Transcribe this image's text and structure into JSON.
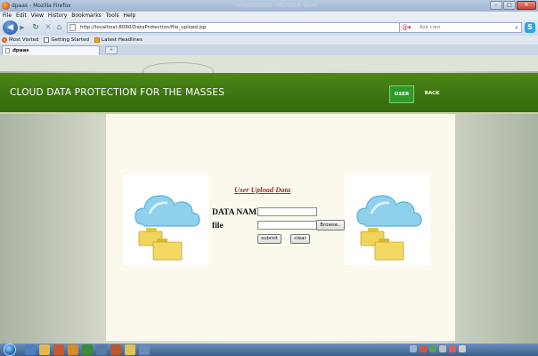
{
  "window": {
    "title": "dpaas - Mozilla Firefox",
    "ghost_title": "ondpaadasds - Microsoft Word",
    "buttons": {
      "minimize": "–",
      "maximize": "□",
      "close": "✕"
    }
  },
  "menu": [
    "File",
    "Edit",
    "View",
    "History",
    "Bookmarks",
    "Tools",
    "Help"
  ],
  "toolbar": {
    "url": "http://localhost:8080/DataProtection/file_upload.jsp",
    "search_placeholder": "Ask.com",
    "icons": [
      "back-icon",
      "forward-icon",
      "reload-icon",
      "stop-icon",
      "home-icon",
      "star-icon",
      "search-icon",
      "skype-icon"
    ]
  },
  "bookmarks": [
    "Most Visited",
    "Getting Started",
    "Latest Headlines"
  ],
  "tab": {
    "label": "dpaas"
  },
  "site": {
    "title": "CLOUD DATA PROTECTION FOR THE MASSES",
    "nav": {
      "user": "USER",
      "back": "BACK"
    }
  },
  "form": {
    "heading": "User Upload Data",
    "data_name_label": "DATA NAME",
    "file_label": "file",
    "browse_label": "Browse..",
    "submit_label": "submit",
    "clear_label": "clear"
  },
  "colors": {
    "header_green": "#3c7410",
    "active_nav": "#2e9a2a",
    "heading_red": "#a52a2a",
    "panel_bg": "#fbf9ee"
  }
}
